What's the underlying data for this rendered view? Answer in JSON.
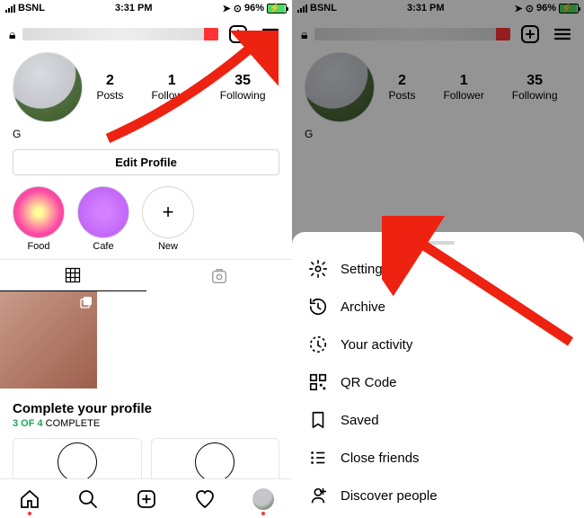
{
  "status": {
    "carrier": "BSNL",
    "time": "3:31 PM",
    "battery": "96%"
  },
  "profile": {
    "stats": {
      "posts_n": "2",
      "posts_l": "Posts",
      "foll_n": "1",
      "foll_l": "Follower",
      "fol2_n": "35",
      "fol2_l": "Following"
    },
    "bio": "G",
    "edit": "Edit Profile",
    "hl": [
      {
        "name": "Food"
      },
      {
        "name": "Cafe"
      },
      {
        "name": "New"
      }
    ],
    "complete": {
      "title": "Complete your profile",
      "done": "3 OF 4",
      "tail": " COMPLETE"
    }
  },
  "menu": [
    {
      "k": "settings",
      "label": "Settings"
    },
    {
      "k": "archive",
      "label": "Archive"
    },
    {
      "k": "activity",
      "label": "Your activity"
    },
    {
      "k": "qr",
      "label": "QR Code"
    },
    {
      "k": "saved",
      "label": "Saved"
    },
    {
      "k": "close",
      "label": "Close friends"
    },
    {
      "k": "discover",
      "label": "Discover people"
    }
  ]
}
